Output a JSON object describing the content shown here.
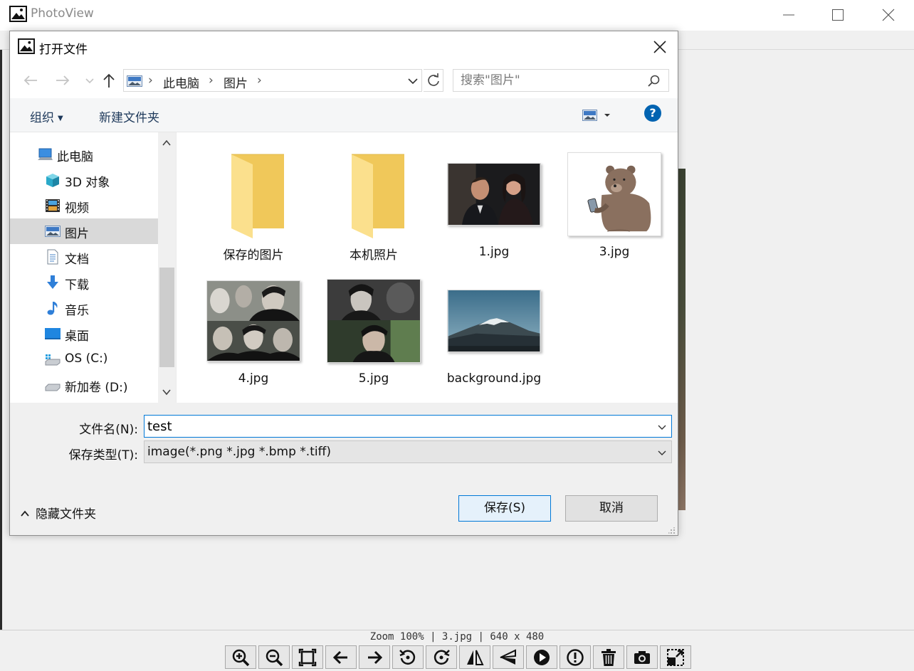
{
  "app": {
    "title": "PhotoView",
    "status": {
      "zoom": "Zoom 100%",
      "file": "3.jpg",
      "size": "640 x 480"
    },
    "toolbar": [
      {
        "icon": "zoom-in-icon"
      },
      {
        "icon": "zoom-out-icon"
      },
      {
        "icon": "fit-window-icon"
      },
      {
        "icon": "previous-arrow-icon"
      },
      {
        "icon": "next-arrow-icon"
      },
      {
        "icon": "rotate-left-icon"
      },
      {
        "icon": "rotate-right-icon"
      },
      {
        "icon": "flip-horizontal-icon"
      },
      {
        "icon": "flip-vertical-icon"
      },
      {
        "icon": "play-icon"
      },
      {
        "icon": "info-icon"
      },
      {
        "icon": "trash-icon"
      },
      {
        "icon": "camera-icon"
      },
      {
        "icon": "resize-icon"
      }
    ]
  },
  "dialog": {
    "title": "打开文件",
    "address": {
      "crumbs": [
        "此电脑",
        "图片"
      ]
    },
    "search": {
      "placeholder": "搜索\"图片\""
    },
    "commands": {
      "organize": "组织",
      "new_folder": "新建文件夹",
      "help": "?"
    },
    "nav_items": [
      {
        "label": "此电脑",
        "icon": "computer-icon"
      },
      {
        "label": "3D 对象",
        "icon": "3d-objects-icon"
      },
      {
        "label": "视频",
        "icon": "video-icon"
      },
      {
        "label": "图片",
        "icon": "pictures-icon",
        "selected": true
      },
      {
        "label": "文档",
        "icon": "document-icon"
      },
      {
        "label": "下载",
        "icon": "download-icon"
      },
      {
        "label": "音乐",
        "icon": "music-icon"
      },
      {
        "label": "桌面",
        "icon": "desktop-icon"
      },
      {
        "label": "OS (C:)",
        "icon": "system-drive-icon"
      },
      {
        "label": "新加卷 (D:)",
        "icon": "drive-icon"
      }
    ],
    "files": [
      {
        "name": "保存的图片",
        "kind": "folder"
      },
      {
        "name": "本机照片",
        "kind": "folder"
      },
      {
        "name": "1.jpg",
        "kind": "image"
      },
      {
        "name": "3.jpg",
        "kind": "image"
      },
      {
        "name": "4.jpg",
        "kind": "image"
      },
      {
        "name": "5.jpg",
        "kind": "image"
      },
      {
        "name": "background.jpg",
        "kind": "image"
      }
    ],
    "filename": {
      "label": "文件名(N):",
      "value": "test"
    },
    "filetype": {
      "label": "保存类型(T):",
      "value": "image(*.png *.jpg *.bmp *.tiff)"
    },
    "hide_folders": "隐藏文件夹",
    "save_button": "保存(S)",
    "cancel_button": "取消"
  }
}
